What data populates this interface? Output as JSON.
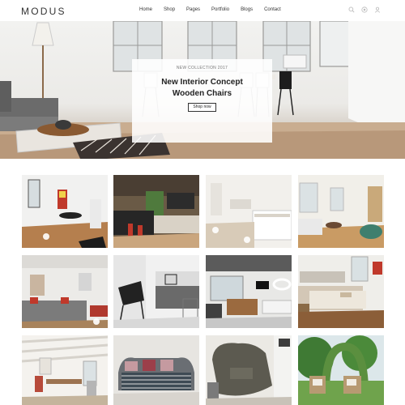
{
  "header": {
    "logo": "MODUS",
    "nav": [
      "Home",
      "Shop",
      "Pages",
      "Portfolio",
      "Blogs",
      "Contact"
    ],
    "icons": [
      "search-icon",
      "cart-icon",
      "user-icon"
    ]
  },
  "hero": {
    "kicker": "NEW COLLECTION 2017",
    "title_line1": "New Interior Concept",
    "title_line2": "Wooden Chairs",
    "cta": "Shop now",
    "slide_count": 3
  },
  "gallery": {
    "rows": 3,
    "columns": 4,
    "items": [
      "black-white-apartment",
      "dark-kitchen",
      "white-kitchen",
      "bright-living-room",
      "grey-sofa-living-room",
      "black-armchair-corner",
      "loft-lounge",
      "wooden-bedroom",
      "attic-dining-room",
      "striped-bench-sofa",
      "green-armchair",
      "garden-patio"
    ]
  }
}
